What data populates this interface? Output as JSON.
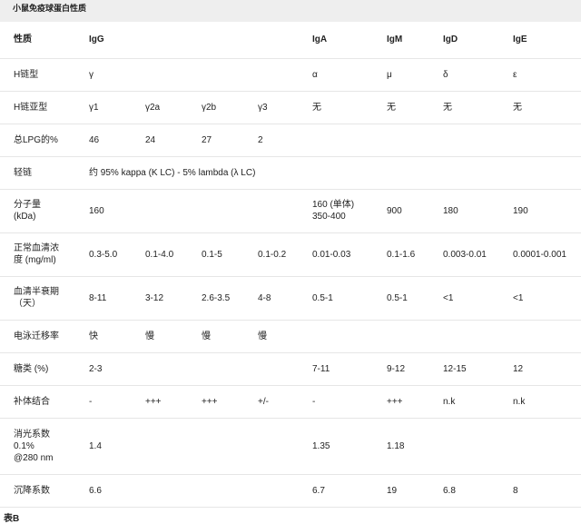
{
  "caption": "小鼠免疫球蛋白性质",
  "header": [
    "性质",
    "IgG",
    "",
    "",
    "",
    "IgA",
    "IgM",
    "IgD",
    "IgE"
  ],
  "rows": [
    {
      "label": "H链型",
      "cells": [
        "γ",
        "",
        "",
        "",
        "α",
        "μ",
        "δ",
        "ε"
      ]
    },
    {
      "label": "H链亚型",
      "cells": [
        "γ1",
        "γ2a",
        "γ2b",
        "γ3",
        "无",
        "无",
        "无",
        "无"
      ]
    },
    {
      "label": "总LPG的%",
      "cells": [
        "46",
        "24",
        "27",
        "2",
        "",
        "",
        "",
        ""
      ]
    },
    {
      "label": "轻链",
      "span_text": "约 95% kappa (K LC) - 5% lambda (λ LC)"
    },
    {
      "label": "分子量\n(kDa)",
      "cells": [
        "160",
        "",
        "",
        "",
        "160 (单体)\n350-400",
        "900",
        "180",
        "190"
      ]
    },
    {
      "label": "正常血清浓\n度 (mg/ml)",
      "cells": [
        "0.3-5.0",
        "0.1-4.0",
        "0.1-5",
        "0.1-0.2",
        "0.01-0.03",
        "0.1-1.6",
        "0.003-0.01",
        "0.0001-0.001"
      ]
    },
    {
      "label": "血清半衰期\n（天）",
      "cells": [
        "8-11",
        "3-12",
        "2.6-3.5",
        "4-8",
        "0.5-1",
        "0.5-1",
        "<1",
        "<1"
      ]
    },
    {
      "label": "电泳迁移率",
      "cells": [
        "快",
        "慢",
        "慢",
        "慢",
        "",
        "",
        "",
        ""
      ]
    },
    {
      "label": "糖类 (%)",
      "cells": [
        "2-3",
        "",
        "",
        "",
        "7-11",
        "9-12",
        "12-15",
        "12"
      ]
    },
    {
      "label": "补体结合",
      "cells": [
        "-",
        "+++",
        "+++",
        "+/-",
        "-",
        "+++",
        "n.k",
        "n.k"
      ]
    },
    {
      "label": "消光系数\n0.1%\n@280 nm",
      "cells": [
        "1.4",
        "",
        "",
        "",
        "1.35",
        "1.18",
        "",
        ""
      ]
    },
    {
      "label": "沉降系数",
      "cells": [
        "6.6",
        "",
        "",
        "",
        "6.7",
        "19",
        "6.8",
        "8"
      ]
    }
  ],
  "footer": "表B"
}
